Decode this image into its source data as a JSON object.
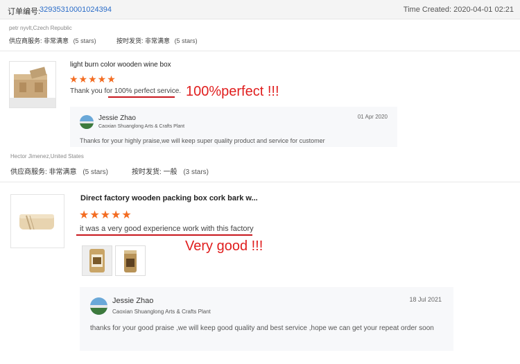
{
  "order": {
    "label": "订单编号:",
    "number": "32935310001024394",
    "time_created": "Time Created: 2020-04-01 02:21"
  },
  "buyer1": {
    "name": "petr nyvlt,Czech Republic",
    "service_label": "供应商服务:",
    "service_value": "非常满意",
    "service_stars": "(5 stars)",
    "ship_label": "按时发货:",
    "ship_value": "非常满意",
    "ship_stars": "(5 stars)"
  },
  "review1": {
    "title": "light burn color wooden wine box",
    "stars": "★★★★★",
    "rating": 5,
    "text": "Thank you for 100% perfect service.",
    "annotation": "100%perfect  !!!",
    "reply": {
      "seller": "Jessie Zhao",
      "plant": "Caoxian Shuanglong Arts & Crafts Plant",
      "date": "01 Apr 2020",
      "text": "Thanks for your highly praise,we will keep super quality product and service for customer"
    }
  },
  "buyer2": {
    "name": "Hector Jimenez,United States",
    "service_label": "供应商服务:",
    "service_value": "非常满意",
    "service_stars": "(5 stars)",
    "ship_label": "按时发货:",
    "ship_value": "一般",
    "ship_stars": "(3 stars)"
  },
  "review2": {
    "title": "Direct factory wooden packing box cork bark w...",
    "stars": "★★★★★",
    "rating": 5,
    "text": "it was a very good experience work with this factory",
    "annotation": "Very good !!!",
    "reply": {
      "seller": "Jessie Zhao",
      "plant": "Caoxian Shuanglong Arts & Crafts Plant",
      "date": "18 Jul 2021",
      "text": "thanks for your good praise ,we will keep good quality and best service ,hope we can get your repeat order soon"
    }
  },
  "colors": {
    "star": "#f36c21",
    "annotation_red": "#e01e1e",
    "order_link": "#2a6cc8"
  }
}
